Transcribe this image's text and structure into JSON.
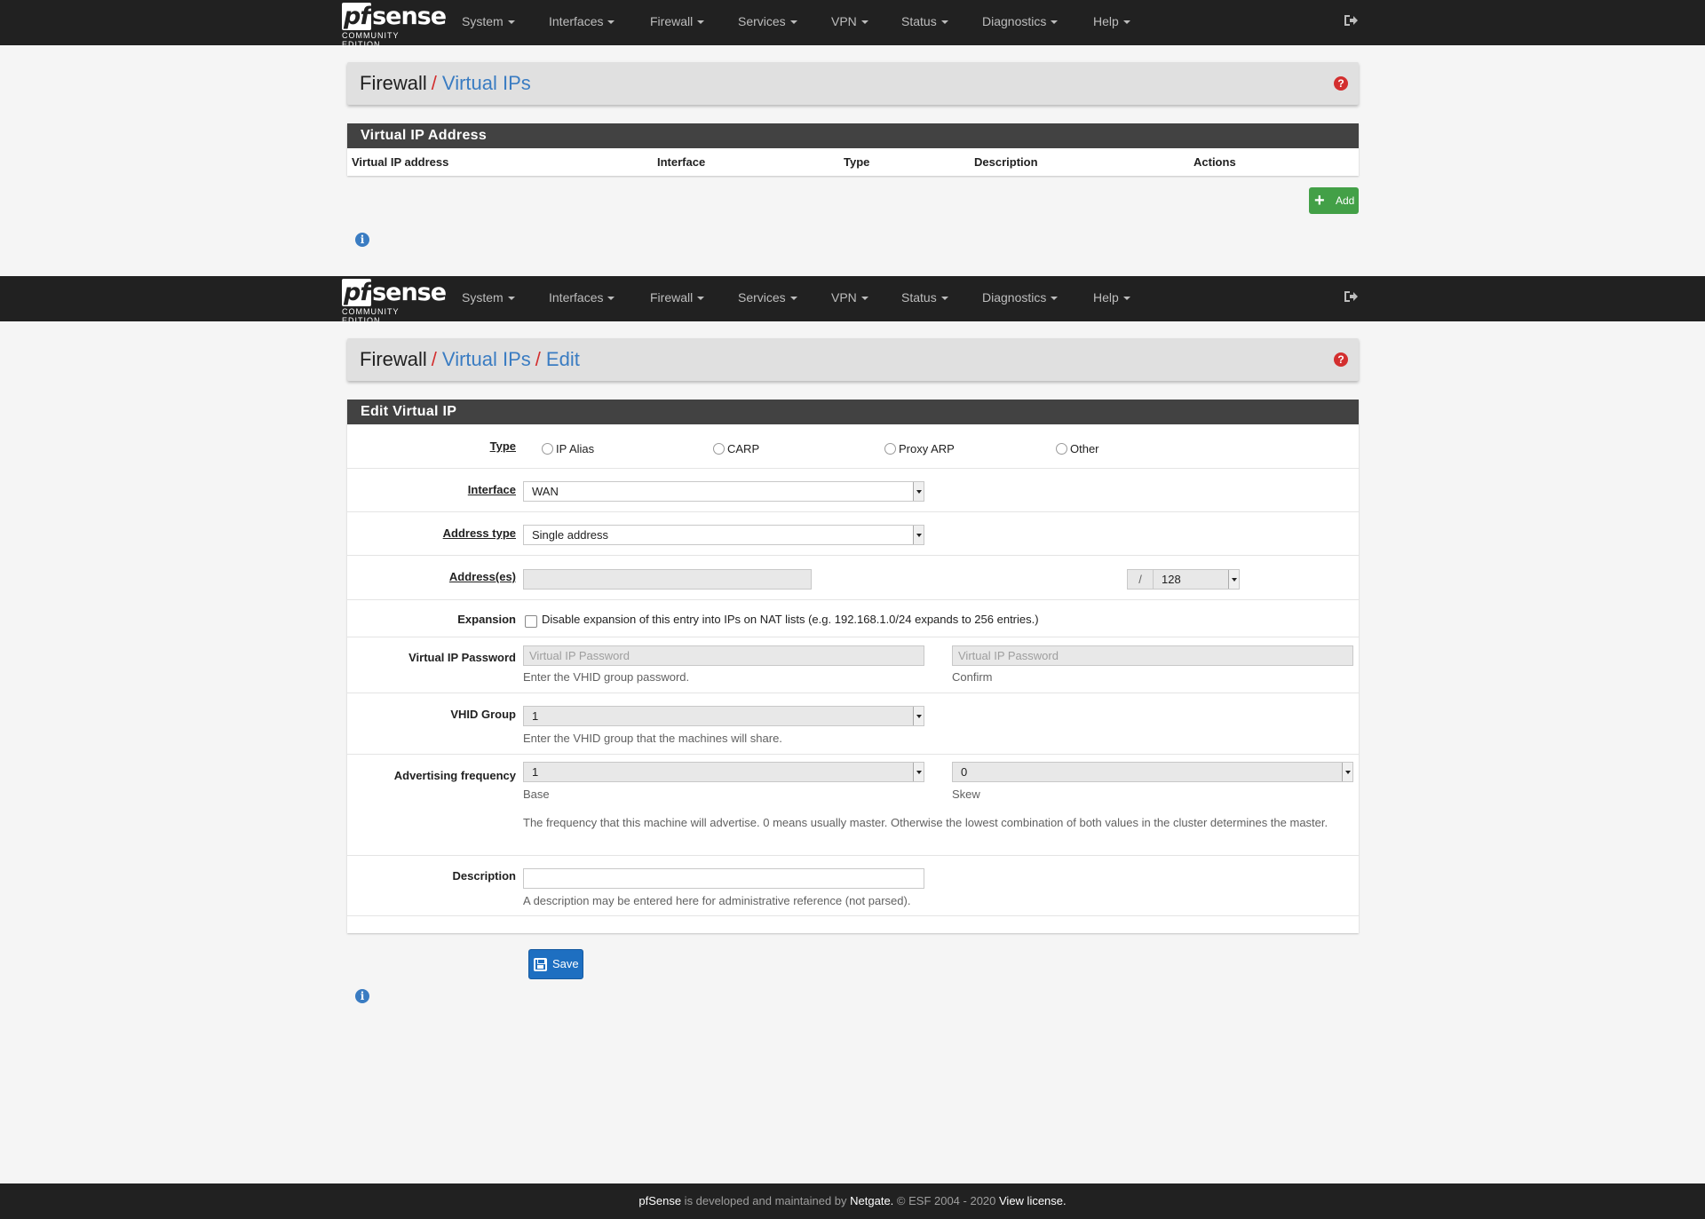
{
  "brand": {
    "logo_prefix": "pf",
    "logo_main": "sense",
    "logo_sub": "COMMUNITY EDITION"
  },
  "nav": {
    "items": [
      "System",
      "Interfaces",
      "Firewall",
      "Services",
      "VPN",
      "Status",
      "Diagnostics",
      "Help"
    ],
    "logout_icon": "sign-out-icon"
  },
  "list_view": {
    "breadcrumb": {
      "root": "Firewall",
      "sep": "/",
      "page": "Virtual IPs"
    },
    "panel_title": "Virtual IP Address",
    "columns": [
      "Virtual IP address",
      "Interface",
      "Type",
      "Description",
      "Actions"
    ],
    "add_button": "Add",
    "add_icon": "plus-icon",
    "info_icon": "info-icon"
  },
  "edit_view": {
    "breadcrumb": {
      "root": "Firewall",
      "sep": "/",
      "page": "Virtual IPs",
      "sub": "Edit"
    },
    "panel_title": "Edit Virtual IP",
    "type": {
      "label": "Type",
      "options": [
        "IP Alias",
        "CARP",
        "Proxy ARP",
        "Other"
      ]
    },
    "interface": {
      "label": "Interface",
      "value": "WAN"
    },
    "address_type": {
      "label": "Address type",
      "value": "Single address"
    },
    "addresses": {
      "label": "Address(es)",
      "value": "",
      "slash": "/",
      "mask": "128"
    },
    "expansion": {
      "label": "Expansion",
      "checkbox_text": "Disable expansion of this entry into IPs on NAT lists (e.g. 192.168.1.0/24 expands to 256 entries.)"
    },
    "password": {
      "label": "Virtual IP Password",
      "placeholder": "Virtual IP Password",
      "confirm_placeholder": "Virtual IP Password",
      "hint": "Enter the VHID group password.",
      "confirm_hint": "Confirm"
    },
    "vhid": {
      "label": "VHID Group",
      "value": "1",
      "hint": "Enter the VHID group that the machines will share."
    },
    "adv": {
      "label": "Advertising frequency",
      "base_value": "1",
      "base_hint": "Base",
      "skew_value": "0",
      "skew_hint": "Skew",
      "hint": "The frequency that this machine will advertise. 0 means usually master. Otherwise the lowest combination of both values in the cluster determines the master."
    },
    "description": {
      "label": "Description",
      "value": "",
      "hint": "A description may be entered here for administrative reference (not parsed)."
    },
    "save_button": "Save",
    "save_icon": "save-icon",
    "info_icon": "info-icon"
  },
  "footer": {
    "p1": "pfSense",
    "p2": " is developed and maintained by ",
    "p3": "Netgate.",
    "p4": " © ESF 2004 - 2020 ",
    "p5": "View license."
  },
  "colors": {
    "navbar": "#212121",
    "accent": "#3a7cc2",
    "danger": "#d32f2f",
    "success": "#43a047",
    "panel_head": "#424242"
  }
}
